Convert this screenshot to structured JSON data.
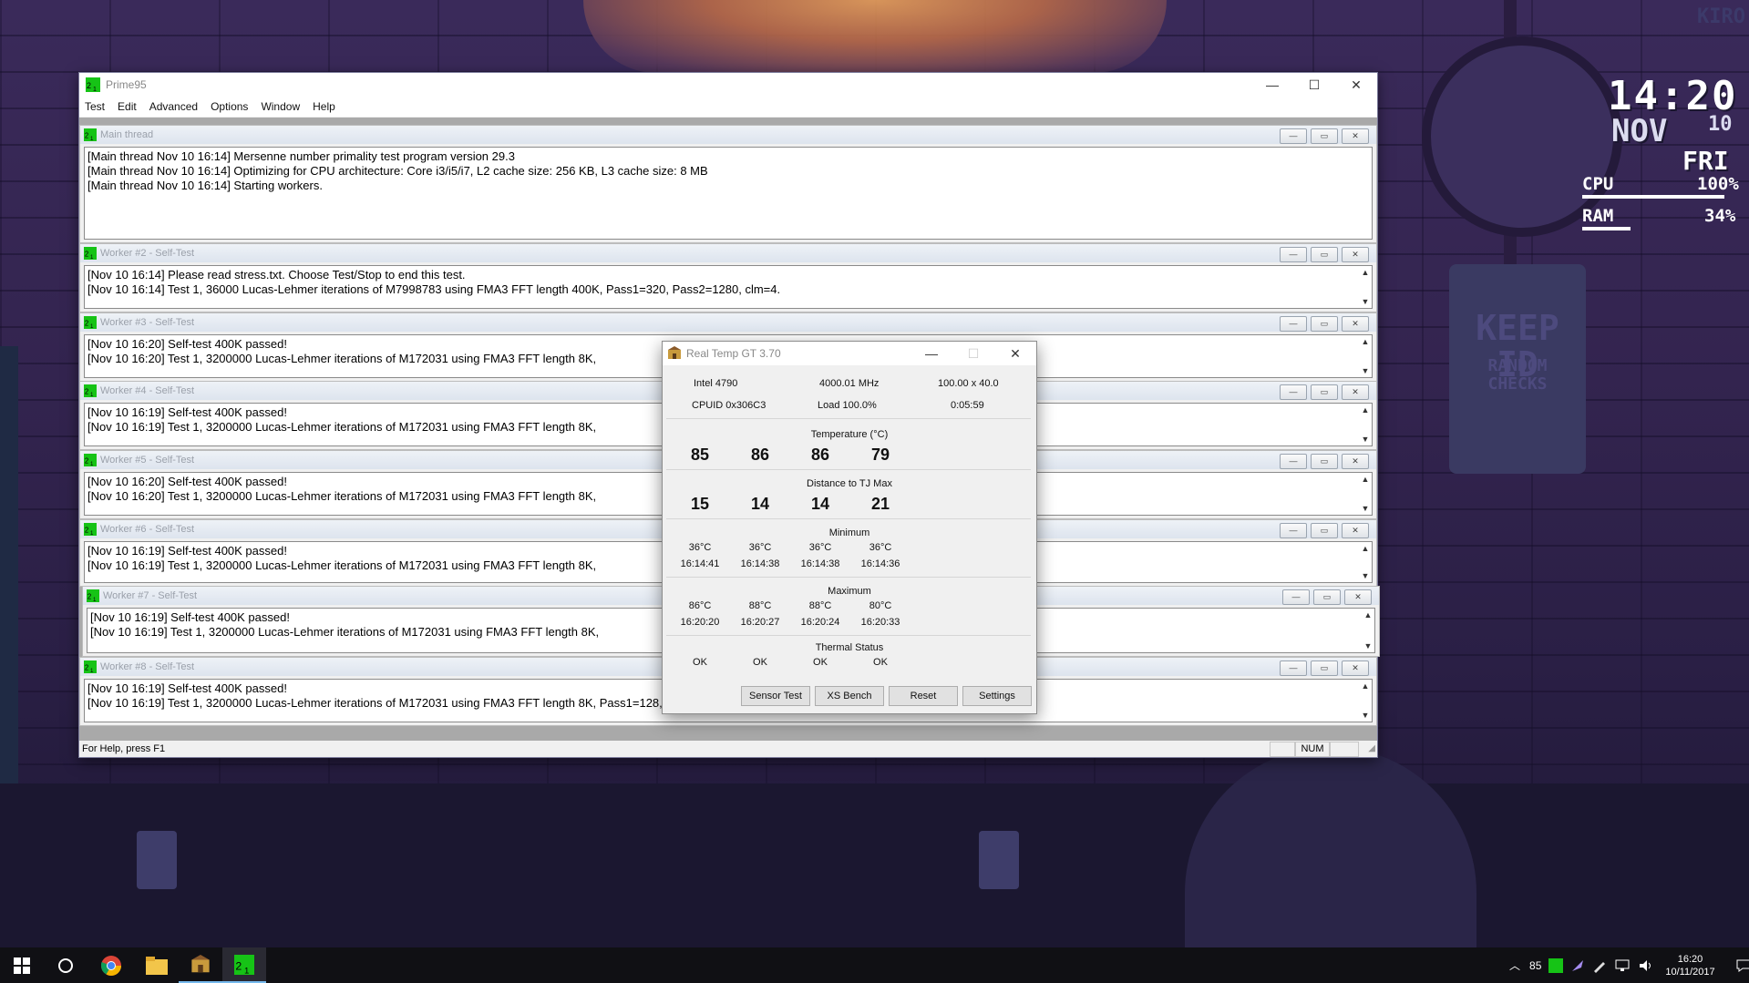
{
  "desktop": {
    "sign_text": "KEEP ID",
    "sign_sub": "RANDOM CHECKS",
    "corner_text": "KIRO"
  },
  "rainmeter": {
    "time": "14:20",
    "month": "NOV",
    "day": "10",
    "weekday": "FRI",
    "cpu_label": "CPU",
    "cpu_value": "100%",
    "cpu_percent": 100,
    "ram_label": "RAM",
    "ram_value": "34%",
    "ram_percent": 34
  },
  "prime95": {
    "title": "Prime95",
    "menu": [
      "Test",
      "Edit",
      "Advanced",
      "Options",
      "Window",
      "Help"
    ],
    "status_left": "For Help, press F1",
    "status_num": "NUM",
    "windows": [
      {
        "title": "Main thread",
        "lines": [
          "[Main thread Nov 10 16:14] Mersenne number primality test program version 29.3",
          "[Main thread Nov 10 16:14] Optimizing for CPU architecture: Core i3/i5/i7, L2 cache size: 256 KB, L3 cache size: 8 MB",
          "[Main thread Nov 10 16:14] Starting workers."
        ]
      },
      {
        "title": "Worker #2 - Self-Test",
        "lines": [
          "[Nov 10 16:14] Please read stress.txt.  Choose Test/Stop to end this test.",
          "[Nov 10 16:14] Test 1, 36000 Lucas-Lehmer iterations of M7998783 using FMA3 FFT length 400K, Pass1=320, Pass2=1280, clm=4."
        ]
      },
      {
        "title": "Worker #3 - Self-Test",
        "lines": [
          "[Nov 10 16:20] Self-test 400K passed!",
          "[Nov 10 16:20] Test 1, 3200000 Lucas-Lehmer iterations of M172031 using FMA3 FFT length 8K,"
        ]
      },
      {
        "title": "Worker #4 - Self-Test",
        "lines": [
          "[Nov 10 16:19] Self-test 400K passed!",
          "[Nov 10 16:19] Test 1, 3200000 Lucas-Lehmer iterations of M172031 using FMA3 FFT length 8K,"
        ]
      },
      {
        "title": "Worker #5 - Self-Test",
        "lines": [
          "[Nov 10 16:20] Self-test 400K passed!",
          "[Nov 10 16:20] Test 1, 3200000 Lucas-Lehmer iterations of M172031 using FMA3 FFT length 8K,"
        ]
      },
      {
        "title": "Worker #6 - Self-Test",
        "lines": [
          "[Nov 10 16:19] Self-test 400K passed!",
          "[Nov 10 16:19] Test 1, 3200000 Lucas-Lehmer iterations of M172031 using FMA3 FFT length 8K,"
        ]
      },
      {
        "title": "Worker #7 - Self-Test",
        "lines": [
          "[Nov 10 16:19] Self-test 400K passed!",
          "[Nov 10 16:19] Test 1, 3200000 Lucas-Lehmer iterations of M172031 using FMA3 FFT length 8K,"
        ]
      },
      {
        "title": "Worker #8 - Self-Test",
        "lines": [
          "[Nov 10 16:19] Self-test 400K passed!",
          "[Nov 10 16:19] Test 1, 3200000 Lucas-Lehmer iterations of M172031 using FMA3 FFT length 8K, Pass1=128, Pass2=64, clm=2."
        ]
      }
    ]
  },
  "realtemp": {
    "title": "Real Temp GT 3.70",
    "cpu_name": "Intel 4790",
    "cpu_freq": "4000.01 MHz",
    "multiplier": "100.00 x 40.0",
    "cpuid": "CPUID  0x306C3",
    "load": "Load 100.0%",
    "elapsed": "0:05:59",
    "temperature_label": "Temperature (°C)",
    "temperatures": [
      "85",
      "86",
      "86",
      "79"
    ],
    "distance_label": "Distance to TJ Max",
    "distances": [
      "15",
      "14",
      "14",
      "21"
    ],
    "minimum_label": "Minimum",
    "minimum_temps": [
      "36°C",
      "36°C",
      "36°C",
      "36°C"
    ],
    "minimum_times": [
      "16:14:41",
      "16:14:38",
      "16:14:38",
      "16:14:36"
    ],
    "maximum_label": "Maximum",
    "maximum_temps": [
      "86°C",
      "88°C",
      "88°C",
      "80°C"
    ],
    "maximum_times": [
      "16:20:20",
      "16:20:27",
      "16:20:24",
      "16:20:33"
    ],
    "thermal_label": "Thermal Status",
    "thermal_status": [
      "OK",
      "OK",
      "OK",
      "OK"
    ],
    "buttons": [
      "Sensor Test",
      "XS Bench",
      "Reset",
      "Settings"
    ]
  },
  "taskbar": {
    "tray_temp": "85",
    "clock_time": "16:20",
    "clock_date": "10/11/2017"
  }
}
